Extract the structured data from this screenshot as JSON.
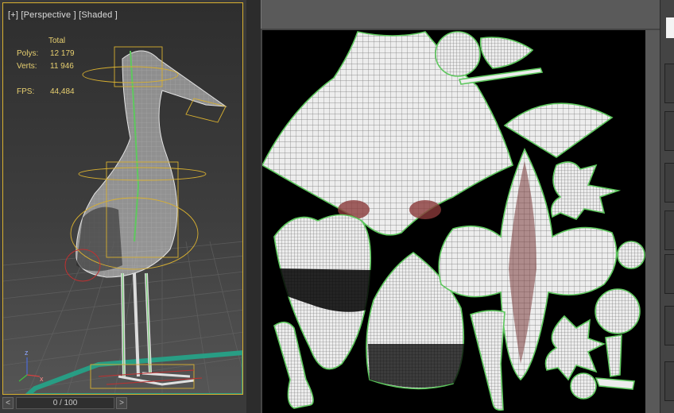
{
  "viewport": {
    "label": "[+] [Perspective ] [Shaded ]",
    "stats": {
      "header": "Total",
      "polys_label": "Polys:",
      "polys_value": "12 179",
      "verts_label": "Verts:",
      "verts_value": "11 946",
      "fps_label": "FPS:",
      "fps_value": "44,484"
    }
  },
  "timeline": {
    "prev_label": "<",
    "frame_label": "0 / 100",
    "next_label": ">"
  },
  "colors": {
    "seam": "#5ec85e",
    "selection": "#d8b030",
    "mesh_fill": "#e9e9e9",
    "uv_background": "#000000"
  }
}
